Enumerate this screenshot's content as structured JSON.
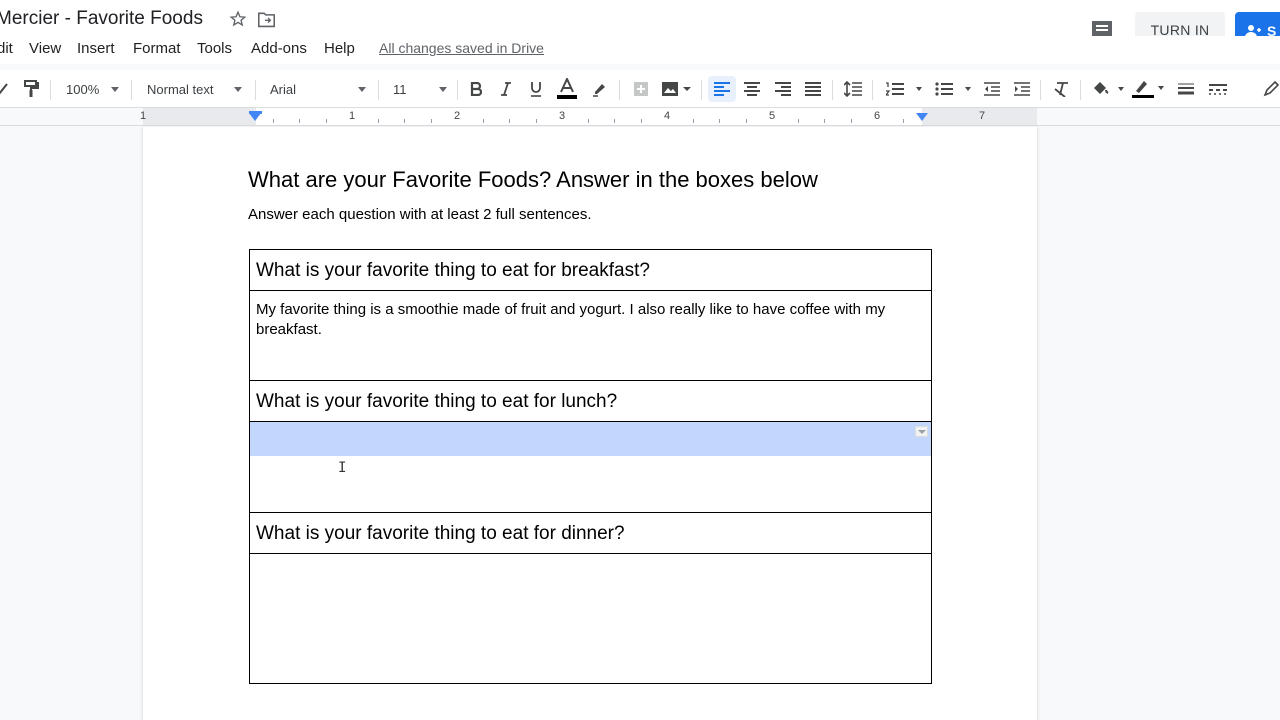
{
  "header": {
    "doc_title": "Mercier - Favorite Foods",
    "turn_in_label": "TURN IN",
    "share_label": "S",
    "accent_color": "#1a73e8"
  },
  "menu": {
    "items": [
      "dit",
      "View",
      "Insert",
      "Format",
      "Tools",
      "Add-ons",
      "Help"
    ],
    "save_status": "All changes saved in Drive"
  },
  "toolbar": {
    "zoom": "100%",
    "style": "Normal text",
    "font": "Arial",
    "font_size": "11",
    "icons": [
      "paint-format-icon",
      "bold-icon",
      "italic-icon",
      "underline-icon",
      "text-color-icon",
      "highlight-icon",
      "insert-link-icon",
      "insert-image-icon",
      "align-left-icon",
      "align-center-icon",
      "align-right-icon",
      "align-justify-icon",
      "line-spacing-icon",
      "numbered-list-icon",
      "bulleted-list-icon",
      "decrease-indent-icon",
      "increase-indent-icon",
      "clear-formatting-icon",
      "fill-color-icon",
      "border-color-icon",
      "border-width-icon",
      "border-dash-icon"
    ]
  },
  "ruler": {
    "numbers": [
      "1",
      "1",
      "2",
      "3",
      "4",
      "5",
      "6",
      "7"
    ]
  },
  "document": {
    "heading": "What are your Favorite Foods? Answer in the boxes below",
    "subtitle": "Answer each question with at least 2 full sentences.",
    "questions": [
      {
        "question": "What is your favorite thing to eat for breakfast?",
        "answer": "My favorite thing is a smoothie made of fruit and yogurt. I also really like to have coffee with my breakfast."
      },
      {
        "question": "What is your favorite thing to eat for lunch?",
        "answer": ""
      },
      {
        "question": "What is your favorite thing to eat for dinner?",
        "answer": ""
      }
    ]
  }
}
